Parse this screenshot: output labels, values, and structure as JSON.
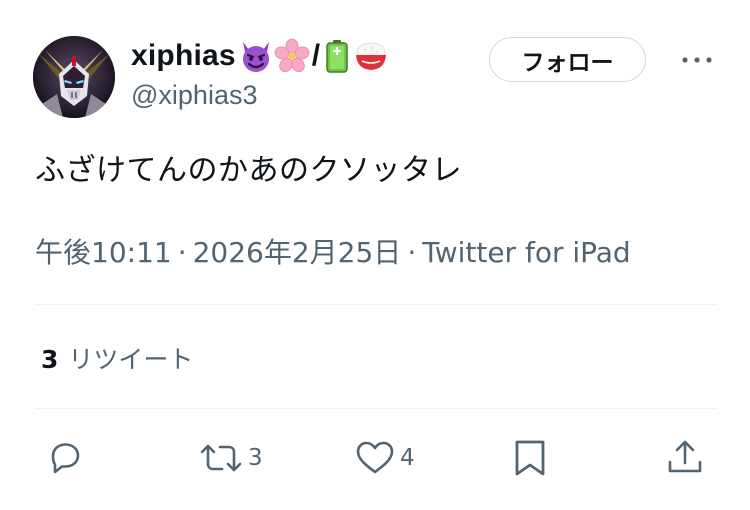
{
  "author": {
    "display_name": "xiphias",
    "name_separator": "/",
    "name_emojis": [
      "smiling-devil-emoji",
      "cherry-blossom-emoji",
      "battery-emoji",
      "rice-bowl-emoji"
    ],
    "handle": "@xiphias3"
  },
  "follow_button": {
    "label": "フォロー"
  },
  "tweet": {
    "text": "ふざけてんのかあのクソッタレ",
    "time": "午後10:11",
    "date": "2026年2月25日",
    "separator": "·",
    "source": "Twitter for iPad"
  },
  "stats": {
    "retweet_count": "3",
    "retweet_label": "リツイート"
  },
  "actions": {
    "reply_icon": "reply-icon",
    "retweet_icon": "retweet-icon",
    "retweet_count": "3",
    "like_icon": "heart-icon",
    "like_count": "4",
    "bookmark_icon": "bookmark-icon",
    "share_icon": "share-icon"
  },
  "colors": {
    "text_primary": "#0f1419",
    "text_secondary": "#536471",
    "border": "#cfd9de",
    "divider": "#eff3f4"
  }
}
